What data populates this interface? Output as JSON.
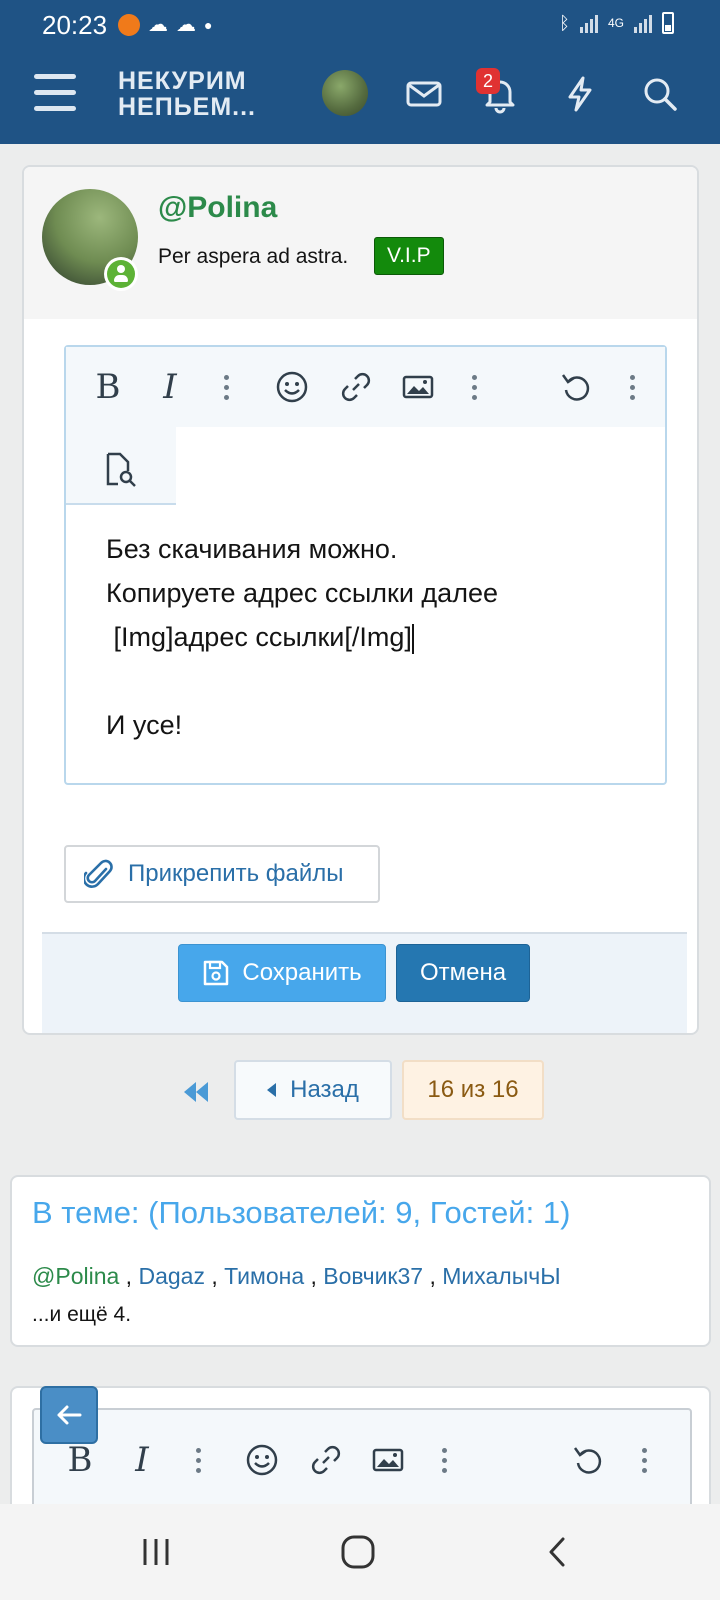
{
  "status": {
    "time": "20:23",
    "network": "4G"
  },
  "header": {
    "logo_line1": "НЕКУРИМ",
    "logo_line2": "НЕПЬЕМ...",
    "notification_count": "2",
    "accent": "#1f5385"
  },
  "post": {
    "username": "@Polina",
    "user_title": "Per aspera ad astra.",
    "badge": "V.I.P",
    "editor_lines": [
      "Без скачивания можно.",
      "Копируете адрес ссылки далее",
      "[Img]адрес ссылки[/Img]",
      "",
      "И усе!"
    ],
    "attach_label": "Прикрепить файлы",
    "save_label": "Сохранить",
    "cancel_label": "Отмена"
  },
  "pagination": {
    "back_label": "Назад",
    "current": "16 из 16"
  },
  "online": {
    "title": "В теме: (Пользователей: 9, Гостей: 1)",
    "users": [
      "@Polina",
      "Dagaz",
      "Тимона",
      "Вовчик37",
      "МихалычЫ"
    ],
    "separator": " , ",
    "more": "...и ещё 4."
  },
  "icons": {
    "toolbar": [
      "bold-icon",
      "italic-icon",
      "more-icon",
      "emoji-icon",
      "link-icon",
      "image-icon",
      "more-icon",
      "undo-icon",
      "more-icon",
      "preview-icon"
    ],
    "header": [
      "menu-icon",
      "mail-icon",
      "bell-icon",
      "bolt-icon",
      "search-icon"
    ]
  }
}
